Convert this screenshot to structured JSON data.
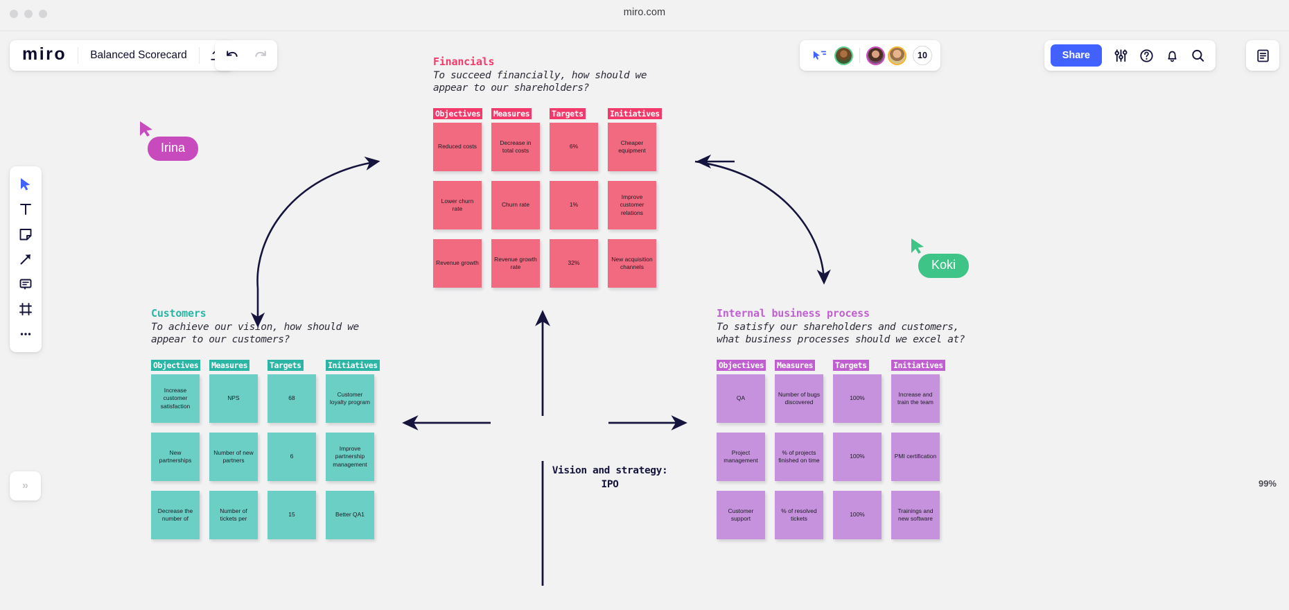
{
  "browser": {
    "url": "miro.com"
  },
  "header": {
    "logo": "miro",
    "board_title": "Balanced Scorecard",
    "export_icon": "upload-icon",
    "undo_icon": "undo-icon",
    "redo_icon": "redo-icon",
    "presenter_icon": "presentation-cursor-icon",
    "collaborator_count": "10",
    "share_label": "Share",
    "settings_icon": "sliders-icon",
    "help_icon": "question-circle-icon",
    "notifications_icon": "bell-icon",
    "search_icon": "search-icon",
    "panel_icon": "notes-panel-icon"
  },
  "toolbar": {
    "items": [
      {
        "name": "select-tool",
        "icon": "cursor-arrow-icon"
      },
      {
        "name": "text-tool",
        "icon": "text-t-icon"
      },
      {
        "name": "sticky-note-tool",
        "icon": "sticky-note-icon"
      },
      {
        "name": "shapes-connector-tool",
        "icon": "arrow-diagonal-icon"
      },
      {
        "name": "comment-tool",
        "icon": "comment-bubble-icon"
      },
      {
        "name": "frame-tool",
        "icon": "frame-icon"
      },
      {
        "name": "more-tools",
        "icon": "ellipsis-icon"
      }
    ]
  },
  "canvas": {
    "zoom_level": "99%",
    "expand_label": "»",
    "center": {
      "line1": "Vision and strategy:",
      "line2": "IPO"
    }
  },
  "cursors": [
    {
      "name": "Irina",
      "color": "#c74bbd"
    },
    {
      "name": "Koki",
      "color": "#3ec486"
    }
  ],
  "colors": {
    "financials_accent": "#f2396a",
    "financials_sticky": "#f26a80",
    "customers_accent": "#2ab5a5",
    "customers_sticky": "#6bcfc5",
    "internal_accent": "#c05fd0",
    "internal_sticky": "#c692dd",
    "share_button": "#4262ff"
  },
  "quadrants": {
    "financials": {
      "title": "Financials",
      "subtitle": "To succeed financially, how should we\nappear to our shareholders?",
      "columns": [
        "Objectives",
        "Measures",
        "Targets",
        "Initiatives"
      ],
      "rows": [
        [
          "Reduced costs",
          "Decrease in total costs",
          "6%",
          "Cheaper equipment"
        ],
        [
          "Lower churn rate",
          "Churn rate",
          "1%",
          "Improve customer relations"
        ],
        [
          "Revenue growth",
          "Revenue growth rate",
          "32%",
          "New acquisition channels"
        ]
      ]
    },
    "customers": {
      "title": "Customers",
      "subtitle": "To achieve our vision, how should we\nappear to our customers?",
      "columns": [
        "Objectives",
        "Measures",
        "Targets",
        "Initiatives"
      ],
      "rows": [
        [
          "Increase customer satisfaction",
          "NPS",
          "68",
          "Customer loyalty program"
        ],
        [
          "New partnerships",
          "Number of new partners",
          "6",
          "Improve partnership management"
        ],
        [
          "Decrease the number of",
          "Number of tickets per",
          "15",
          "Better QA1"
        ]
      ]
    },
    "internal": {
      "title": "Internal business process",
      "subtitle": "To satisfy our shareholders and customers,\nwhat business processes should we excel at?",
      "columns": [
        "Objectives",
        "Measures",
        "Targets",
        "Initiatives"
      ],
      "rows": [
        [
          "QA",
          "Number of bugs discovered",
          "100%",
          "Increase and train the team"
        ],
        [
          "Project management",
          "% of projects finished on time",
          "100%",
          "PMI certification"
        ],
        [
          "Customer support",
          "% of resolved tickets",
          "100%",
          "Trainings and new software"
        ]
      ]
    }
  }
}
